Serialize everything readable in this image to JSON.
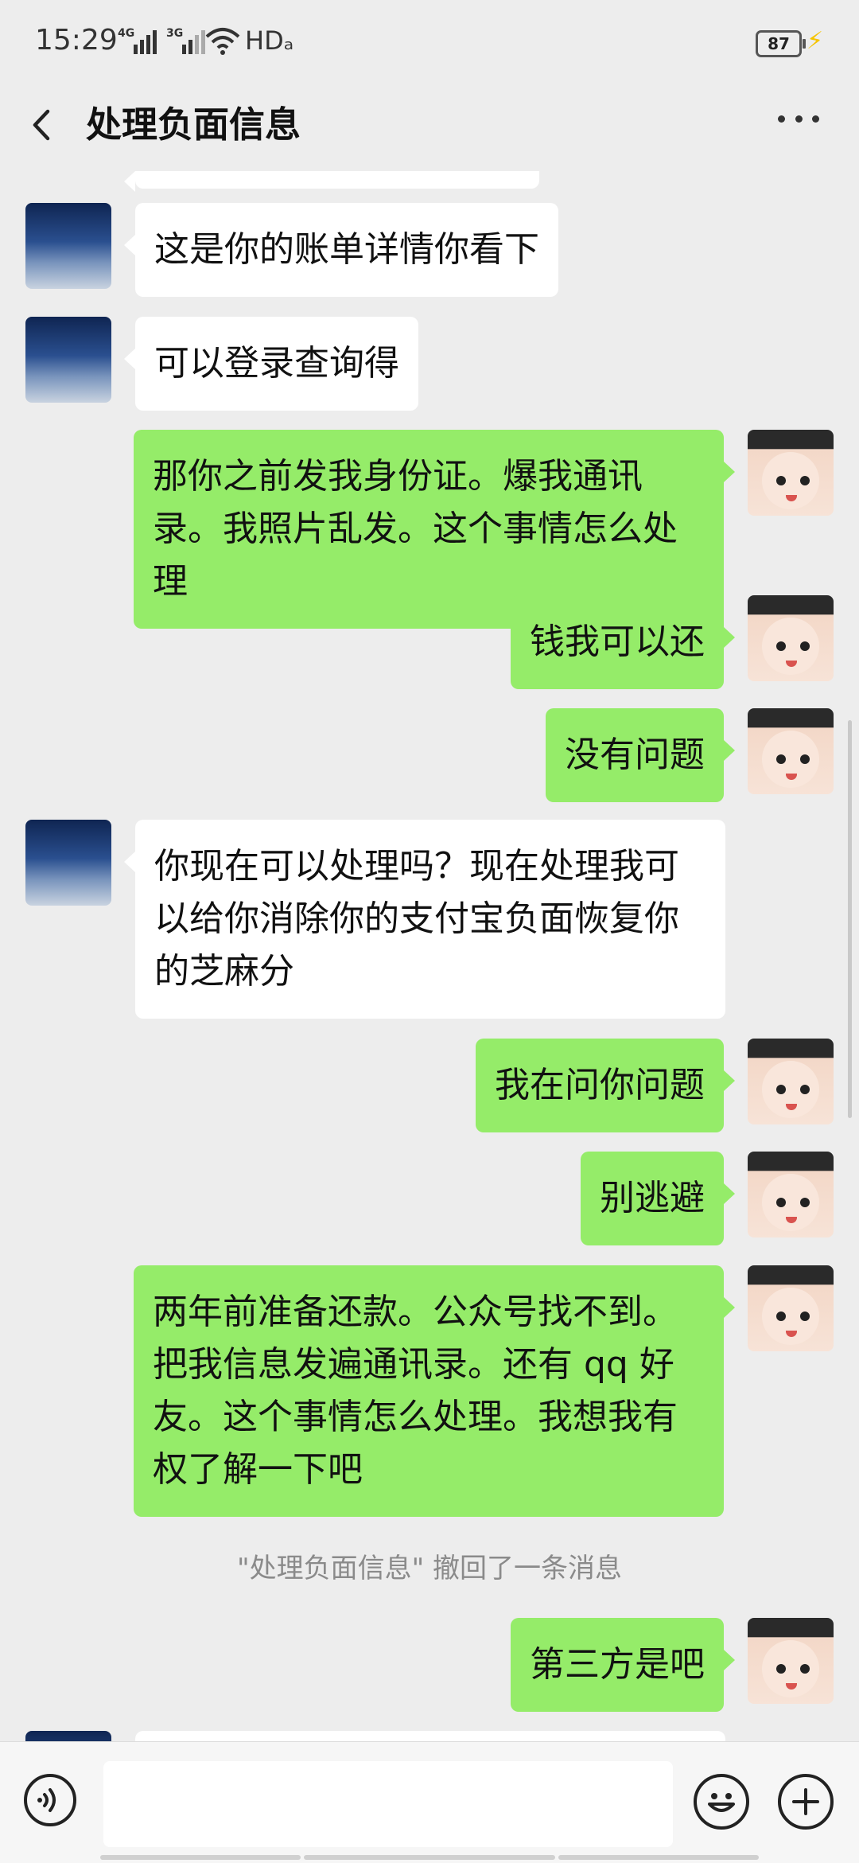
{
  "status": {
    "time": "15:29",
    "net1": "4G",
    "net2": "3G",
    "hd": "HDₐ",
    "battery": "87"
  },
  "header": {
    "title": "处理负面信息"
  },
  "messages": [
    {
      "side": "in",
      "text": "这是你的账单详情你看下"
    },
    {
      "side": "in",
      "text": "可以登录查询得"
    },
    {
      "side": "out",
      "text": "那你之前发我身份证。爆我通讯录。我照片乱发。这个事情怎么处理"
    },
    {
      "side": "out",
      "text": "钱我可以还"
    },
    {
      "side": "out",
      "text": "没有问题"
    },
    {
      "side": "in",
      "text": "你现在可以处理吗？现在处理我可以给你消除你的支付宝负面恢复你的芝麻分"
    },
    {
      "side": "out",
      "text": "我在问你问题"
    },
    {
      "side": "out",
      "text": "别逃避"
    },
    {
      "side": "out",
      "text": "两年前准备还款。公众号找不到。把我信息发遍通讯录。还有 qq 好友。这个事情怎么处理。我想我有权了解一下吧"
    },
    {
      "side": "system",
      "text": "\"处理负面信息\" 撤回了一条消息"
    },
    {
      "side": "out",
      "text": "第三方是吧"
    }
  ],
  "input": {
    "value": ""
  }
}
